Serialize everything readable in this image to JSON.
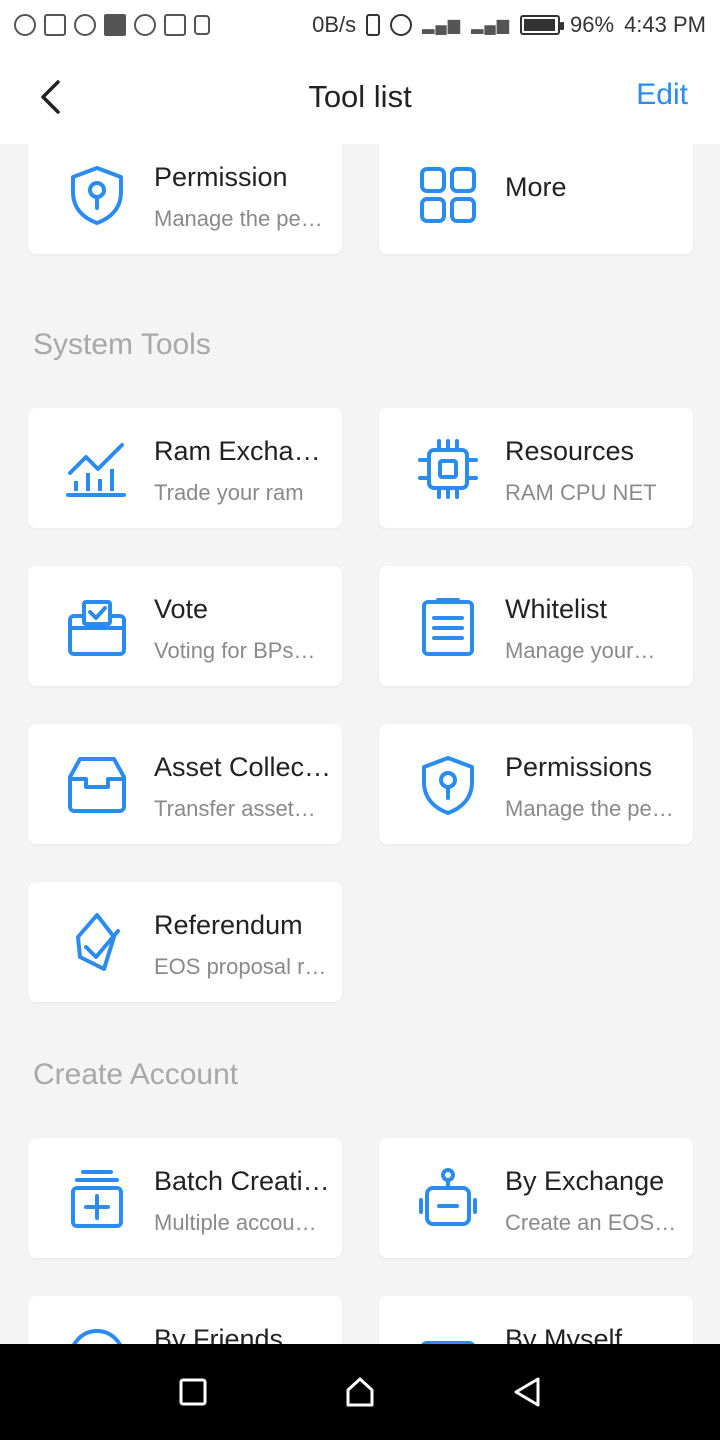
{
  "status_bar": {
    "net_speed": "0B/s",
    "battery_percent": "96%",
    "battery_level": 0.96,
    "time": "4:43 PM",
    "icons": [
      "message-icon",
      "mail-icon",
      "chat-icon",
      "image-placeholder-icon",
      "whatsapp-icon",
      "gallery-icon",
      "lock-icon",
      "vibrate-icon",
      "alarm-icon",
      "signal-icon",
      "signal-icon",
      "battery-icon"
    ]
  },
  "header": {
    "title": "Tool list",
    "edit_label": "Edit"
  },
  "top_tools": [
    {
      "name": "Permission",
      "desc": "Manage the pe…",
      "icon": "shield-key-icon"
    },
    {
      "name": "More",
      "desc": "",
      "icon": "grid-icon"
    }
  ],
  "sections": [
    {
      "title": "System Tools",
      "tools": [
        {
          "name": "Ram Exchan…",
          "desc": "Trade your ram",
          "icon": "chart-trend-icon"
        },
        {
          "name": "Resources",
          "desc": "RAM CPU NET",
          "icon": "chip-icon"
        },
        {
          "name": "Vote",
          "desc": "Voting for BPs…",
          "icon": "ballot-box-icon"
        },
        {
          "name": "Whitelist",
          "desc": "Manage your…",
          "icon": "clipboard-list-icon"
        },
        {
          "name": "Asset Collec…",
          "desc": "Transfer asset…",
          "icon": "inbox-tray-icon"
        },
        {
          "name": "Permissions",
          "desc": "Manage the pe…",
          "icon": "shield-key-icon"
        },
        {
          "name": "Referendum",
          "desc": "EOS proposal r…",
          "icon": "eos-check-icon"
        }
      ]
    },
    {
      "title": "Create Account",
      "tools": [
        {
          "name": "Batch Creati…",
          "desc": "Multiple accou…",
          "icon": "stack-add-icon"
        },
        {
          "name": "By Exchange",
          "desc": "Create an EOS…",
          "icon": "robot-icon"
        },
        {
          "name": "By Friends",
          "desc": "",
          "icon": "friends-icon"
        },
        {
          "name": "By Myself",
          "desc": "",
          "icon": "keyboard-icon"
        }
      ]
    }
  ],
  "colors": {
    "accent": "#2a8cf0",
    "icon_blue": "#2a8cf0",
    "section_text": "#a8a8a8",
    "background": "#f4f4f4"
  },
  "nav": {
    "buttons": [
      "recent-apps-icon",
      "home-icon",
      "back-triangle-icon"
    ]
  }
}
